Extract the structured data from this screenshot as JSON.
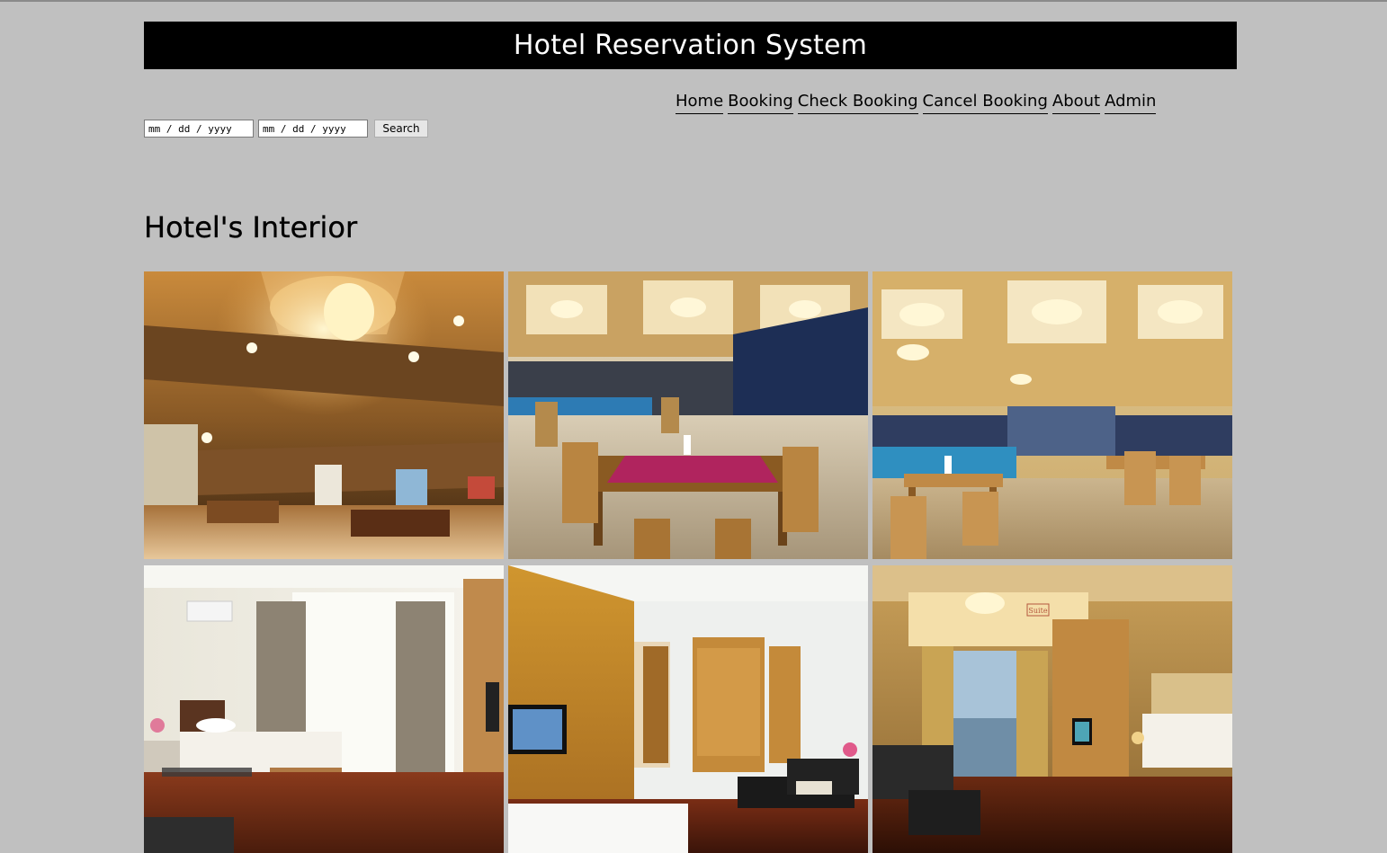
{
  "header": {
    "title": "Hotel Reservation System"
  },
  "nav": {
    "items": [
      "Home",
      "Booking",
      "Check Booking",
      "Cancel Booking",
      "About",
      "Admin"
    ]
  },
  "search": {
    "checkin_placeholder": "mm / dd / yyyy",
    "checkout_placeholder": "mm / dd / yyyy",
    "button_label": "Search"
  },
  "section": {
    "title": "Hotel's Interior"
  },
  "gallery": {
    "suite_sign": "Suite"
  },
  "colors": {
    "page_bg": "#c0c0c0",
    "header_bg": "#000000",
    "header_text": "#ffffff",
    "wood": "#b8863b",
    "table_runner": "#b0245e"
  }
}
